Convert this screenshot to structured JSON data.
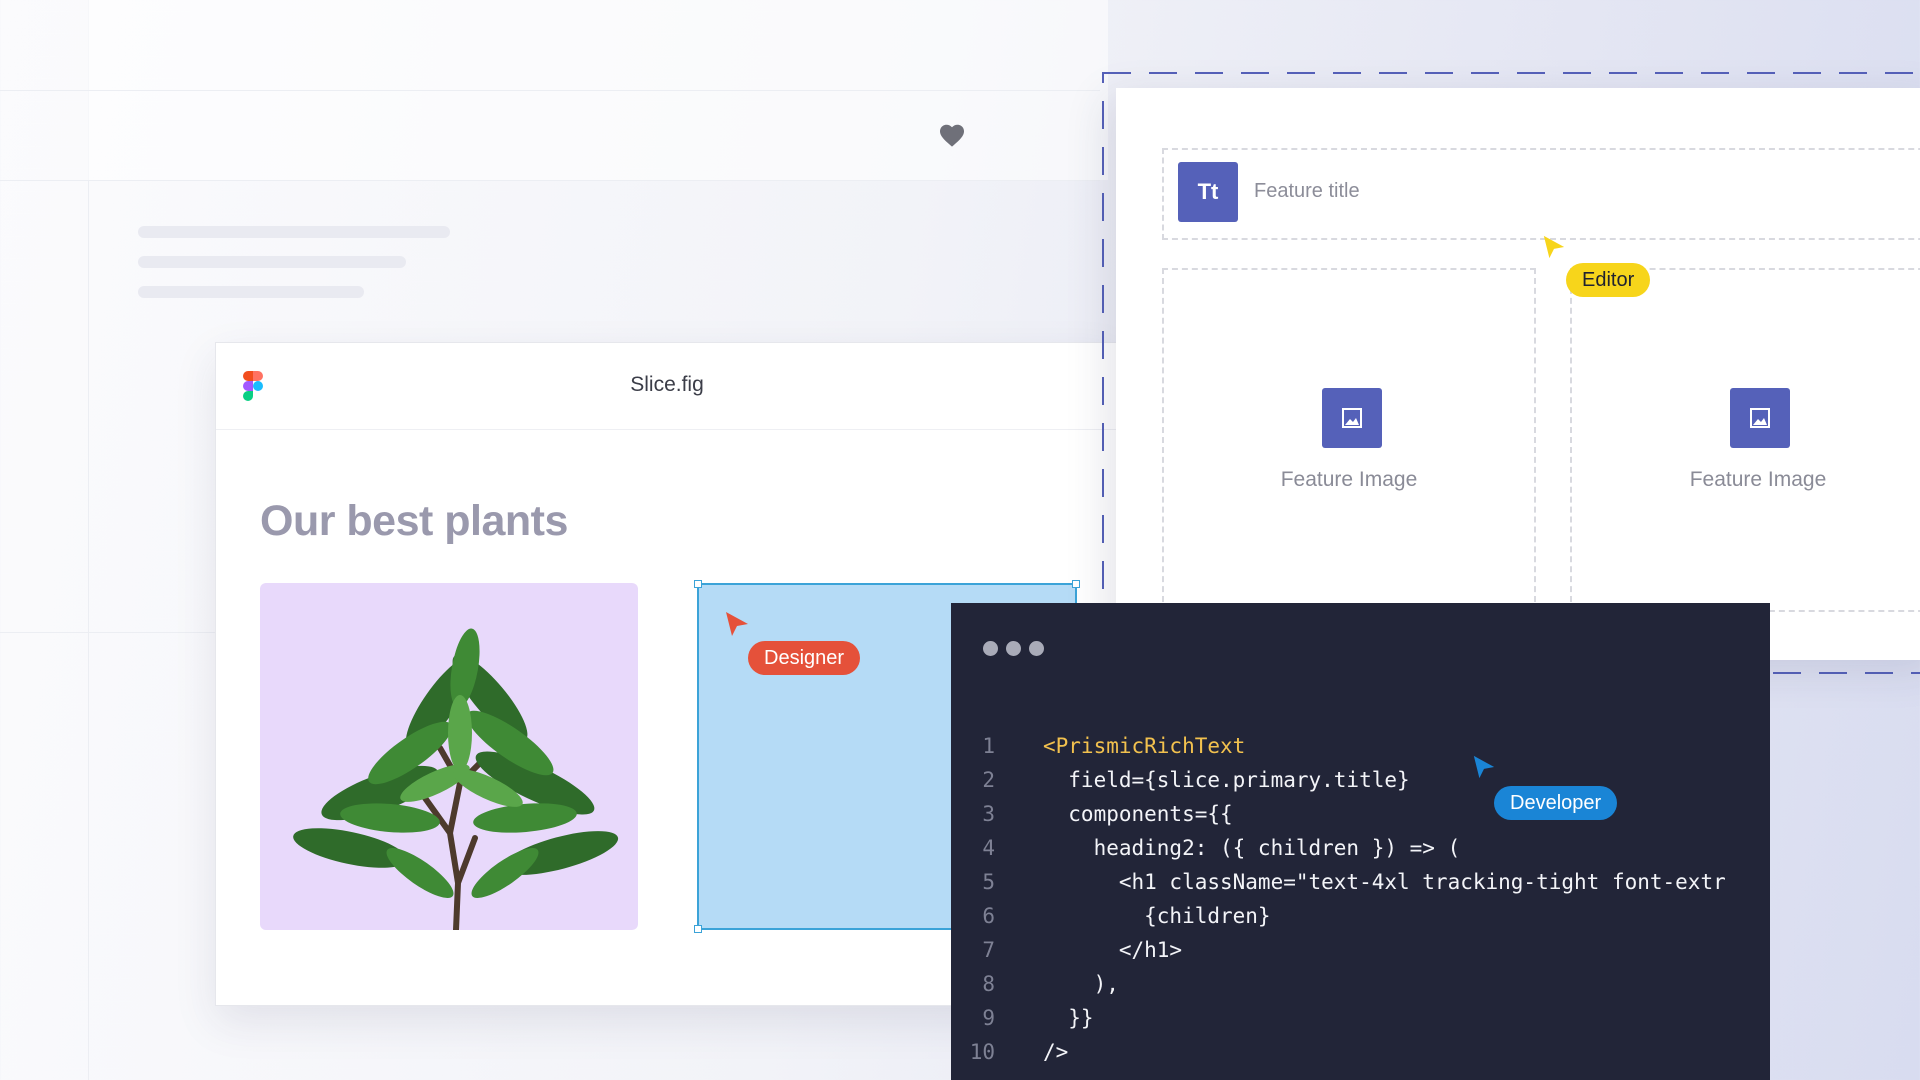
{
  "favorite_icon": "heart-icon",
  "figma_window": {
    "title": "Slice.fig",
    "logo": "figma-logo-icon",
    "heading": "Our best plants",
    "plant_card_color": "#e8d9fb",
    "selection_color": "#b5dbf6"
  },
  "collaborators": {
    "designer": {
      "label": "Designer",
      "color": "#e5513a"
    },
    "editor": {
      "label": "Editor",
      "color": "#f7d51b"
    },
    "developer": {
      "label": "Developer",
      "color": "#1a85d6"
    }
  },
  "editor_panel": {
    "title_field": {
      "icon_text": "Tt",
      "label": "Feature title"
    },
    "image_fields": [
      {
        "label": "Feature Image",
        "icon": "image-icon"
      },
      {
        "label": "Feature Image",
        "icon": "image-icon"
      }
    ],
    "accent": "#5561b9"
  },
  "code_editor": {
    "lines": [
      {
        "n": "1",
        "code": "<PrismicRichText"
      },
      {
        "n": "2",
        "code": "  field={slice.primary.title}"
      },
      {
        "n": "3",
        "code": "  components={{"
      },
      {
        "n": "4",
        "code": "    heading2: ({ children }) => ("
      },
      {
        "n": "5",
        "code": "      <h1 className=\"text-4xl tracking-tight font-extr"
      },
      {
        "n": "6",
        "code": "        {children}"
      },
      {
        "n": "7",
        "code": "      </h1>"
      },
      {
        "n": "8",
        "code": "    ),"
      },
      {
        "n": "9",
        "code": "  }}"
      },
      {
        "n": "10",
        "code": "/>"
      }
    ]
  }
}
